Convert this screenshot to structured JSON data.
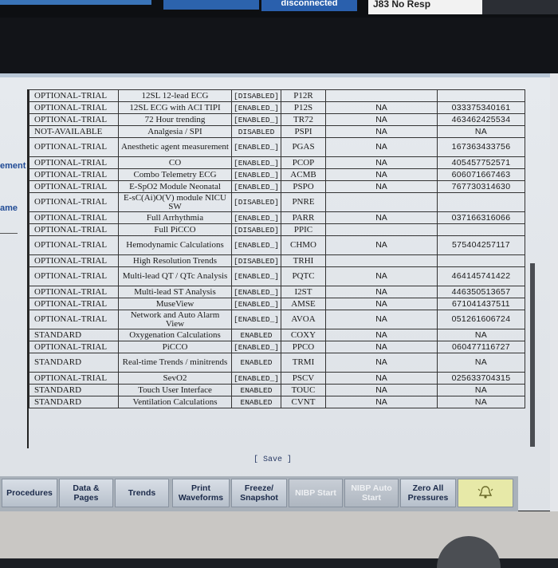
{
  "header": {
    "status_tab": "disconnected",
    "resp_label": "J83 No Resp"
  },
  "left_panel": {
    "fragment1": "ement",
    "fragment2": "ame"
  },
  "table": {
    "rows": [
      {
        "license": "OPTIONAL-TRIAL",
        "name": "12SL 12-lead ECG",
        "status": "[DISABLED]",
        "code": "P12R",
        "na": "",
        "serial": ""
      },
      {
        "license": "OPTIONAL-TRIAL",
        "name": "12SL ECG with ACI TIPI",
        "status": "[ENABLED_]",
        "code": "P12S",
        "na": "NA",
        "serial": "033375340161"
      },
      {
        "license": "OPTIONAL-TRIAL",
        "name": "72 Hour trending",
        "status": "[ENABLED_]",
        "code": "TR72",
        "na": "NA",
        "serial": "463462425534"
      },
      {
        "license": "NOT-AVAILABLE",
        "name": "Analgesia / SPI",
        "status": "DISABLED",
        "code": "PSPI",
        "na": "NA",
        "serial": "NA"
      },
      {
        "license": "OPTIONAL-TRIAL",
        "name": "Anesthetic agent measurement",
        "status": "[ENABLED_]",
        "code": "PGAS",
        "na": "NA",
        "serial": "167363433756"
      },
      {
        "license": "OPTIONAL-TRIAL",
        "name": "CO",
        "status": "[ENABLED_]",
        "code": "PCOP",
        "na": "NA",
        "serial": "405457752571"
      },
      {
        "license": "OPTIONAL-TRIAL",
        "name": "Combo Telemetry ECG",
        "status": "[ENABLED_]",
        "code": "ACMB",
        "na": "NA",
        "serial": "606071667463"
      },
      {
        "license": "OPTIONAL-TRIAL",
        "name": "E-SpO2 Module Neonatal",
        "status": "[ENABLED_]",
        "code": "PSPO",
        "na": "NA",
        "serial": "767730314630"
      },
      {
        "license": "OPTIONAL-TRIAL",
        "name": "E-sC(Ai)O(V) module NICU SW",
        "status": "[DISABLED]",
        "code": "PNRE",
        "na": "",
        "serial": ""
      },
      {
        "license": "OPTIONAL-TRIAL",
        "name": "Full Arrhythmia",
        "status": "[ENABLED_]",
        "code": "PARR",
        "na": "NA",
        "serial": "037166316066"
      },
      {
        "license": "OPTIONAL-TRIAL",
        "name": "Full PiCCO",
        "status": "[DISABLED]",
        "code": "PPIC",
        "na": "",
        "serial": ""
      },
      {
        "license": "OPTIONAL-TRIAL",
        "name": "Hemodynamic Calculations",
        "status": "[ENABLED_]",
        "code": "CHMO",
        "na": "NA",
        "serial": "575404257117"
      },
      {
        "license": "OPTIONAL-TRIAL",
        "name": "High Resolution Trends",
        "status": "[DISABLED]",
        "code": "TRHI",
        "na": "",
        "serial": ""
      },
      {
        "license": "OPTIONAL-TRIAL",
        "name": "Multi-lead QT / QTc Analysis",
        "status": "[ENABLED_]",
        "code": "PQTC",
        "na": "NA",
        "serial": "464145741422"
      },
      {
        "license": "OPTIONAL-TRIAL",
        "name": "Multi-lead ST Analysis",
        "status": "[ENABLED_]",
        "code": "I2ST",
        "na": "NA",
        "serial": "446350513657"
      },
      {
        "license": "OPTIONAL-TRIAL",
        "name": "MuseView",
        "status": "[ENABLED_]",
        "code": "AMSE",
        "na": "NA",
        "serial": "671041437511"
      },
      {
        "license": "OPTIONAL-TRIAL",
        "name": "Network and Auto Alarm View",
        "status": "[ENABLED_]",
        "code": "AVOA",
        "na": "NA",
        "serial": "051261606724"
      },
      {
        "license": "STANDARD",
        "name": "Oxygenation Calculations",
        "status": "ENABLED",
        "code": "COXY",
        "na": "NA",
        "serial": "NA"
      },
      {
        "license": "OPTIONAL-TRIAL",
        "name": "PiCCO",
        "status": "[ENABLED_]",
        "code": "PPCO",
        "na": "NA",
        "serial": "060477116727"
      },
      {
        "license": "STANDARD",
        "name": "Real-time Trends / minitrends",
        "status": "ENABLED",
        "code": "TRMI",
        "na": "NA",
        "serial": "NA"
      },
      {
        "license": "OPTIONAL-TRIAL",
        "name": "SevO2",
        "status": "[ENABLED_]",
        "code": "PSCV",
        "na": "NA",
        "serial": "025633704315"
      },
      {
        "license": "STANDARD",
        "name": "Touch User Interface",
        "status": "ENABLED",
        "code": "TOUC",
        "na": "NA",
        "serial": "NA"
      },
      {
        "license": "STANDARD",
        "name": "Ventilation Calculations",
        "status": "ENABLED",
        "code": "CVNT",
        "na": "NA",
        "serial": "NA"
      }
    ]
  },
  "save_label": "[ Save ]",
  "softkeys": [
    {
      "label": "Procedures",
      "dim": false
    },
    {
      "label": "Data & Pages",
      "dim": false
    },
    {
      "label": "Trends",
      "dim": false
    },
    {
      "label": "Print Waveforms",
      "dim": false
    },
    {
      "label": "Freeze/ Snapshot",
      "dim": false
    },
    {
      "label": "NIBP Start",
      "dim": true
    },
    {
      "label": "NIBP Auto Start",
      "dim": true
    },
    {
      "label": "Zero All Pressures",
      "dim": false
    }
  ],
  "alarm_icon": "bell-alarm-icon"
}
